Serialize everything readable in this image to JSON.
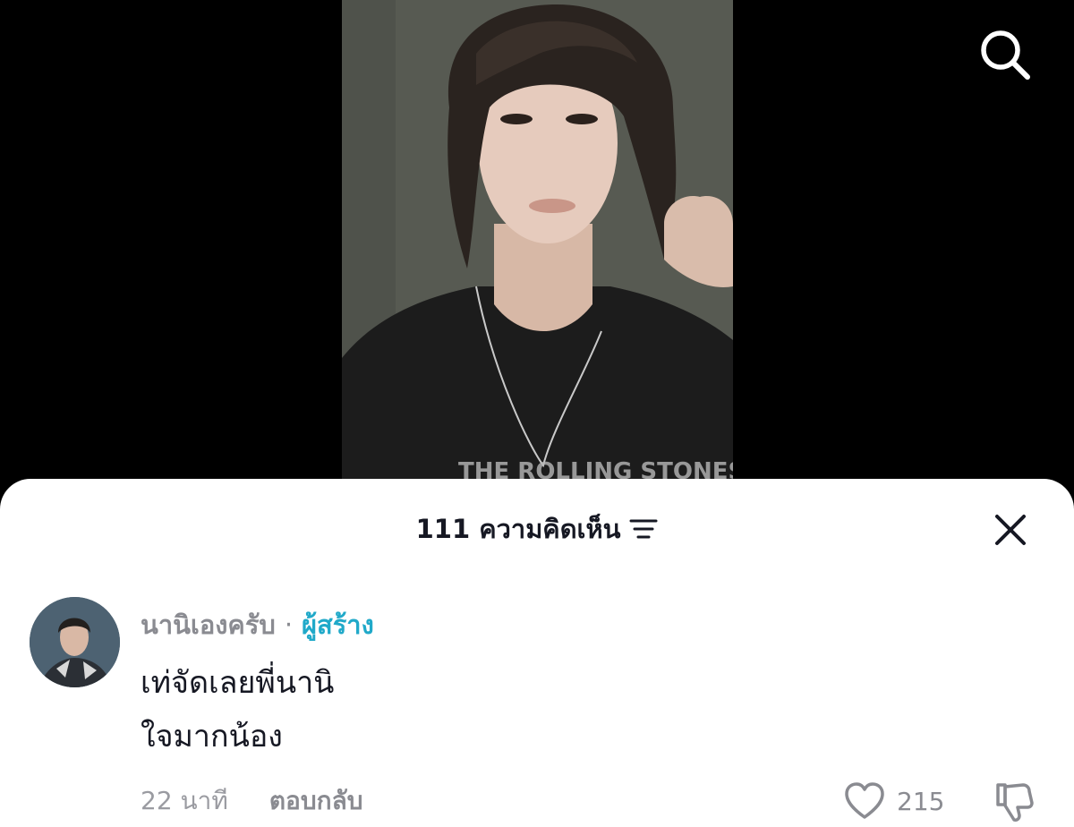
{
  "header": {
    "search_icon": "search-icon"
  },
  "comments_panel": {
    "title": "111 ความคิดเห็น",
    "sort_icon": "sort-lines-icon",
    "close_icon": "close-icon"
  },
  "comment": {
    "username": "นานิเองครับ",
    "separator": "·",
    "creator_badge": "ผู้สร้าง",
    "text_lines": [
      "เท่จัดเลยพี่นานิ",
      "ใจมากน้อง"
    ],
    "time": "22 นาที",
    "reply_label": "ตอบกลับ",
    "like_count": "215",
    "like_icon": "heart-outline-icon",
    "dislike_icon": "thumbs-down-icon"
  },
  "colors": {
    "creator_accent": "#20a9c9",
    "text_primary": "#161823",
    "text_secondary": "#8a8b91"
  }
}
